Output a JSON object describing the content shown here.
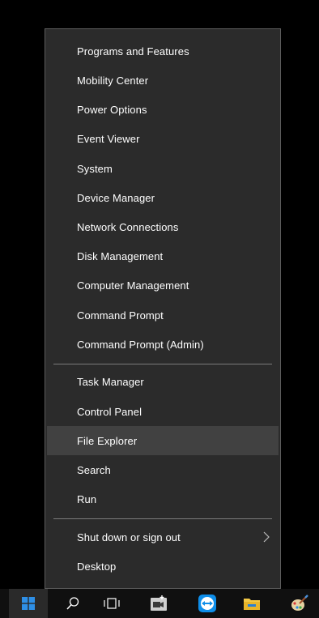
{
  "menu": {
    "group1": [
      "Programs and Features",
      "Mobility Center",
      "Power Options",
      "Event Viewer",
      "System",
      "Device Manager",
      "Network Connections",
      "Disk Management",
      "Computer Management",
      "Command Prompt",
      "Command Prompt (Admin)"
    ],
    "group2": [
      "Task Manager",
      "Control Panel",
      "File Explorer",
      "Search",
      "Run"
    ],
    "group3": [
      "Shut down or sign out",
      "Desktop"
    ],
    "highlighted_item": "File Explorer"
  },
  "taskbar": {
    "icons": [
      "windows-start-icon",
      "search-icon",
      "task-view-icon",
      "camera-app-icon",
      "teamviewer-icon",
      "file-explorer-icon",
      "paint-icon"
    ]
  },
  "colors": {
    "menu_background": "#2b2b2b",
    "menu_border": "#5c5c5c",
    "highlight": "#414141",
    "separator": "#7a7a7a",
    "taskbar": "#101010",
    "start_blue": "#2e8fe6"
  }
}
